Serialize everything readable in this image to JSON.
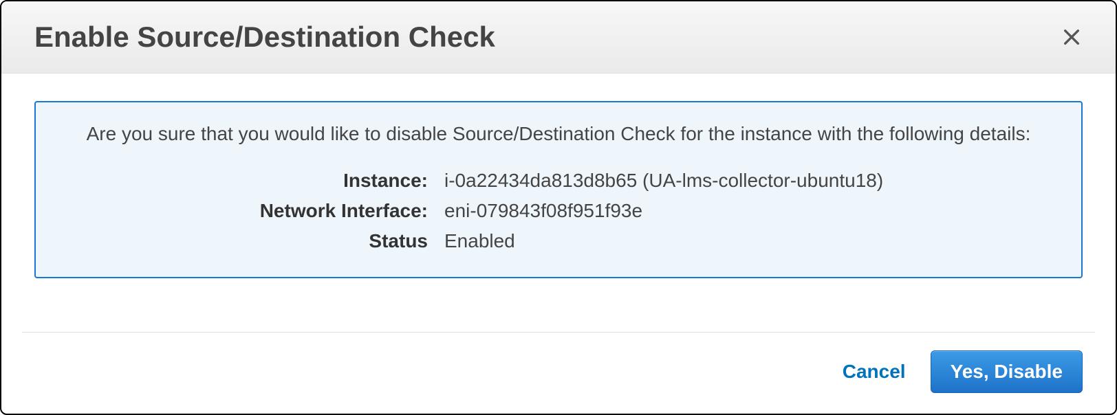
{
  "modal": {
    "title": "Enable Source/Destination Check",
    "confirm_text": "Are you sure that you would like to disable Source/Destination Check for the instance with the following details:",
    "details": {
      "instance_label": "Instance:",
      "instance_value": "i-0a22434da813d8b65 (UA-lms-collector-ubuntu18)",
      "eni_label": "Network Interface:",
      "eni_value": "eni-079843f08f951f93e",
      "status_label": "Status",
      "status_value": "Enabled"
    },
    "buttons": {
      "cancel": "Cancel",
      "confirm": "Yes, Disable"
    }
  }
}
